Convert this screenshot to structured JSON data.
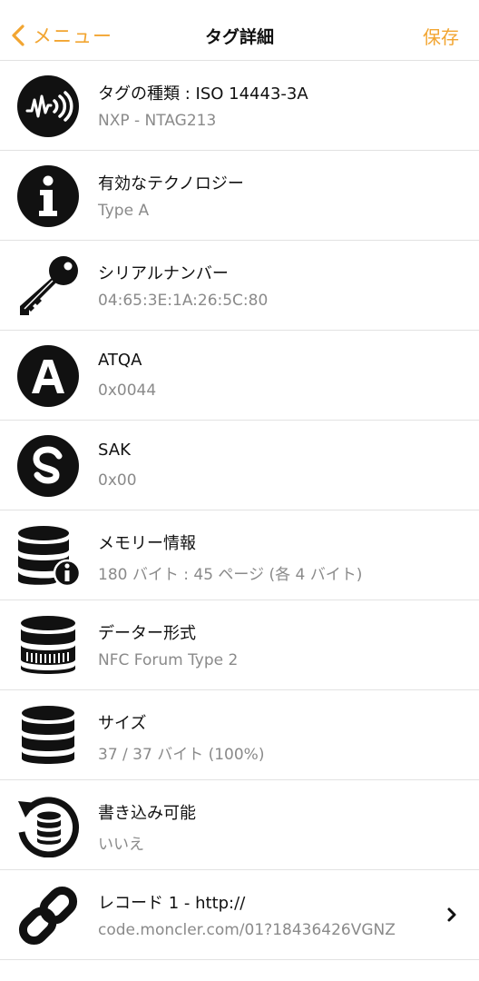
{
  "nav": {
    "back_label": "メニュー",
    "title": "タグ詳細",
    "save_label": "保存"
  },
  "rows": [
    {
      "icon": "nfc-tag-icon",
      "title": "タグの種類 : ISO 14443-3A",
      "subtitle": "NXP - NTAG213"
    },
    {
      "icon": "info-icon",
      "title": "有効なテクノロジー",
      "subtitle": "Type A"
    },
    {
      "icon": "key-icon",
      "title": "シリアルナンバー",
      "subtitle": "04:65:3E:1A:26:5C:80"
    },
    {
      "icon": "letter-a-icon",
      "title": "ATQA",
      "subtitle": "0x0044"
    },
    {
      "icon": "letter-s-icon",
      "title": "SAK",
      "subtitle": "0x00"
    },
    {
      "icon": "database-info-icon",
      "title": "メモリー情報",
      "subtitle": "180 バイト : 45 ページ (各 4 バイト)"
    },
    {
      "icon": "database-format-icon",
      "title": "データー形式",
      "subtitle": "NFC Forum Type 2"
    },
    {
      "icon": "database-icon",
      "title": "サイズ",
      "subtitle": "37 / 37 バイト (100%)"
    },
    {
      "icon": "database-refresh-icon",
      "title": "書き込み可能",
      "subtitle": "いいえ"
    },
    {
      "icon": "link-icon",
      "title": "レコード 1 - http://",
      "subtitle": "code.moncler.com/01?18436426VGNZ"
    }
  ],
  "colors": {
    "accent": "#f2a531",
    "icon": "#111111",
    "subtitle": "#8a8a8a",
    "separator": "#e2e2e2"
  }
}
